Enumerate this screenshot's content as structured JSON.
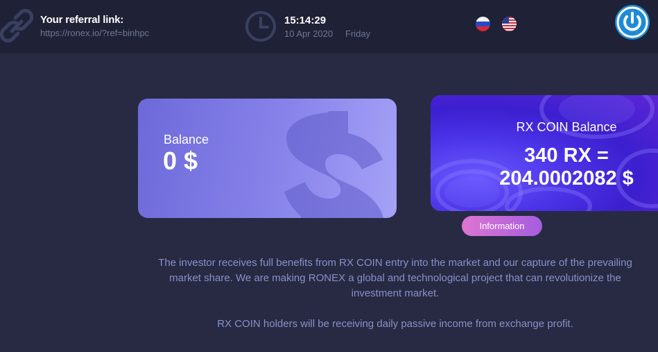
{
  "header": {
    "referral_title": "Your referral link:",
    "referral_url": "https://ronex.io/?ref=binhpc",
    "time": "15:14:29",
    "date": "10 Apr 2020",
    "day": "Friday",
    "languages": [
      "ru-flag-icon",
      "us-flag-icon"
    ],
    "power_icon": "power-icon"
  },
  "balance_card": {
    "label": "Balance",
    "value": "0 $"
  },
  "rx_card": {
    "label": "RX COIN Balance",
    "value_line1": "340 RX =",
    "value_line2": "204.0002082 $"
  },
  "info_button": "Information",
  "description": {
    "line1": "The investor receives full benefits from RX COIN entry into the market and our capture of the prevailing",
    "line2": "market share. We are making RONEX a global and technological project that can revolutionize the",
    "line3": "investment market.",
    "line4": "RX COIN holders will be receiving daily passive income from exchange profit."
  },
  "colors": {
    "background": "#272a42",
    "topbar": "#1f2236",
    "accent_blue": "#1e8bd6",
    "muted_text": "#6f7596",
    "description_text": "#8a90c9"
  }
}
